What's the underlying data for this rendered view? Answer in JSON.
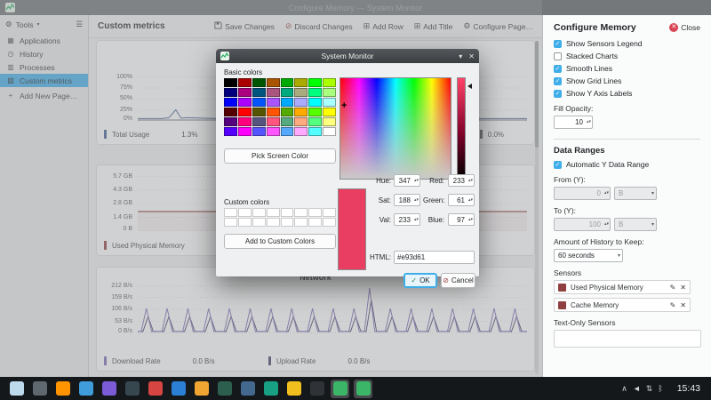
{
  "window": {
    "title": "Configure Memory — System Monitor"
  },
  "sidebar": {
    "tools": {
      "label": "Tools"
    },
    "items": [
      {
        "label": "Applications"
      },
      {
        "label": "History"
      },
      {
        "label": "Processes"
      },
      {
        "label": "Custom metrics"
      },
      {
        "label": "Add New Page…"
      }
    ]
  },
  "header": {
    "title": "Custom metrics",
    "buttons": {
      "save": "Save Changes",
      "discard": "Discard Changes",
      "add_row": "Add Row",
      "add_title": "Add Title",
      "configure": "Configure Page…"
    }
  },
  "charts": {
    "cpu": {
      "ticks": [
        "100%",
        "75%",
        "50%",
        "25%",
        "0%"
      ],
      "legend1_label": "Total Usage",
      "legend1_value": "1.3%",
      "legend2_value": "0.0%",
      "color": "#41608f",
      "legend2_color": "#555b60"
    },
    "memory": {
      "ticks": [
        "5.7 GB",
        "4.3 GB",
        "2.8 GB",
        "1.4 GB",
        "0 B"
      ],
      "legend1_label": "Used Physical Memory",
      "color": "#8f3f3f"
    },
    "network": {
      "title": "Network",
      "ticks": [
        "212 B/s",
        "159 B/s",
        "106 B/s",
        "53 B/s",
        "0 B/s"
      ],
      "legend1_label": "Download Rate",
      "legend1_value": "0.0 B/s",
      "legend2_label": "Upload Rate",
      "legend2_value": "0.0 B/s",
      "color_download": "#7b68b5",
      "color_upload": "#433b66"
    }
  },
  "panel": {
    "title": "Configure Memory",
    "close": "Close",
    "checks": [
      {
        "label": "Show Sensors Legend",
        "checked": true
      },
      {
        "label": "Stacked Charts",
        "checked": false
      },
      {
        "label": "Smooth Lines",
        "checked": true
      },
      {
        "label": "Show Grid Lines",
        "checked": true
      },
      {
        "label": "Show Y Axis Labels",
        "checked": true
      }
    ],
    "fill_opacity_label": "Fill Opacity:",
    "fill_opacity": "10",
    "data_ranges": "Data Ranges",
    "auto_y": "Automatic Y Data Range",
    "from_label": "From (Y):",
    "from_value": "0",
    "from_unit": "B",
    "to_label": "To (Y):",
    "to_value": "100",
    "to_unit": "B",
    "history_label": "Amount of History to Keep:",
    "history_value": "60 seconds",
    "sensors_label": "Sensors",
    "sensors": [
      {
        "label": "Used Physical Memory",
        "color": "#8f3f3f"
      },
      {
        "label": "Cache Memory",
        "color": "#8f3f3f"
      }
    ],
    "text_only_label": "Text-Only Sensors"
  },
  "dialog": {
    "title": "System Monitor",
    "basic_label": "Basic colors",
    "basic_colors": [
      "#000000",
      "#aa0000",
      "#005500",
      "#aa5500",
      "#00aa00",
      "#aaaa00",
      "#00ff00",
      "#aaff00",
      "#00007f",
      "#aa007f",
      "#00557f",
      "#aa557f",
      "#00aa7f",
      "#aaaa7f",
      "#00ff7f",
      "#aaff7f",
      "#0000ff",
      "#aa00ff",
      "#0055ff",
      "#aa55ff",
      "#00aaff",
      "#aaaaff",
      "#00ffff",
      "#aaffff",
      "#550000",
      "#ff0000",
      "#555500",
      "#ff5500",
      "#55aa00",
      "#ffaa00",
      "#55ff00",
      "#ffff00",
      "#55007f",
      "#ff007f",
      "#55557f",
      "#ff557f",
      "#55aa7f",
      "#ffaa7f",
      "#55ff7f",
      "#ffff7f",
      "#5500ff",
      "#ff00ff",
      "#5555ff",
      "#ff55ff",
      "#55aaff",
      "#ffaaff",
      "#55ffff",
      "#ffffff"
    ],
    "pick_screen": "Pick Screen Color",
    "custom_label": "Custom colors",
    "custom_colors": [
      "#ffffff",
      "#ffffff",
      "#ffffff",
      "#ffffff",
      "#ffffff",
      "#ffffff",
      "#ffffff",
      "#ffffff",
      "#ffffff",
      "#ffffff",
      "#ffffff",
      "#ffffff",
      "#ffffff",
      "#ffffff",
      "#ffffff",
      "#ffffff"
    ],
    "add_custom": "Add to Custom Colors",
    "hue_label": "Hue:",
    "hue": "347",
    "sat_label": "Sat:",
    "sat": "188",
    "val_label": "Val:",
    "val": "233",
    "red_label": "Red:",
    "red": "233",
    "green_label": "Green:",
    "green": "61",
    "blue_label": "Blue:",
    "blue": "97",
    "html_label": "HTML:",
    "html": "#e93d61",
    "current_color": "#e93d61",
    "ok": "OK",
    "cancel": "Cancel"
  },
  "taskbar": {
    "clock": "15:43",
    "apps": [
      {
        "name": "app-launcher-icon",
        "color": "#bdd9ec"
      },
      {
        "name": "virtual-desktops-pager-icon",
        "color": "#5e686e"
      },
      {
        "name": "firefox-icon",
        "color": "#ff9400"
      },
      {
        "name": "file-manager-icon",
        "color": "#3f9ddb"
      },
      {
        "name": "app-purple-icon",
        "color": "#7b5cd6"
      },
      {
        "name": "app-dark-icon",
        "color": "#37474f"
      },
      {
        "name": "app-red-icon",
        "color": "#d64541"
      },
      {
        "name": "app-blue-icon",
        "color": "#2b7fd4"
      },
      {
        "name": "app-orange-icon",
        "color": "#f0a432"
      },
      {
        "name": "app-darkgreen-icon",
        "color": "#2d5f4e"
      },
      {
        "name": "app-steelblue-icon",
        "color": "#44698f"
      },
      {
        "name": "app-teal-icon",
        "color": "#18a085"
      },
      {
        "name": "app-flame-icon",
        "color": "#f2c01e"
      },
      {
        "name": "terminal-icon",
        "color": "#2f3337"
      },
      {
        "name": "system-monitor-icon",
        "color": "#3bb567",
        "active": true
      },
      {
        "name": "system-monitor-dialog-icon",
        "color": "#3bb567",
        "active": true
      }
    ],
    "tray": [
      {
        "name": "tray-expand-icon",
        "glyph": "∧"
      },
      {
        "name": "volume-icon",
        "glyph": "◄"
      },
      {
        "name": "network-icon",
        "glyph": "⇅"
      },
      {
        "name": "bluetooth-icon",
        "glyph": "ᛒ"
      }
    ]
  }
}
